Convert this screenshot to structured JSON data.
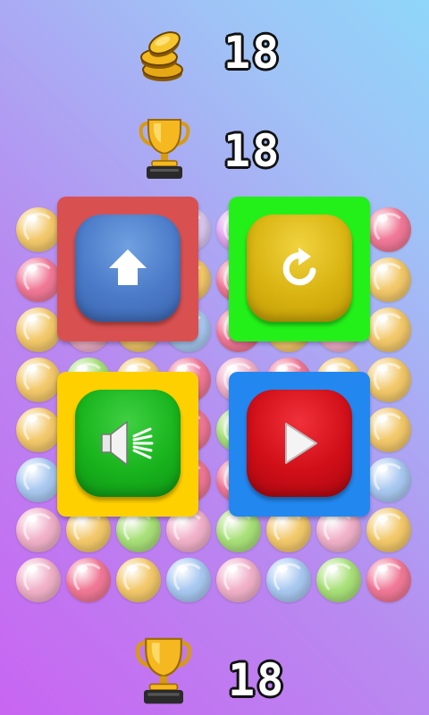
{
  "stats": {
    "coins": "18",
    "best_score": "18",
    "last_score": "18"
  },
  "buttons": [
    {
      "name": "home",
      "icon": "house-icon",
      "tile_color": "#d95050",
      "button_color": "#4b7ac8"
    },
    {
      "name": "restart",
      "icon": "restart-icon",
      "tile_color": "#23f019",
      "button_color": "#d8b310"
    },
    {
      "name": "sound",
      "icon": "speaker-icon",
      "tile_color": "#ffd000",
      "button_color": "#18b31d"
    },
    {
      "name": "play",
      "icon": "play-icon",
      "tile_color": "#2288f0",
      "button_color": "#d00e18"
    }
  ],
  "background_balls": [
    [
      "#f2c86a",
      "#f08fa8",
      "#f3cc6e",
      "#d8c8f0",
      "#e1a5f0",
      "#8fd0f0",
      "#f2c86a",
      "#f07896"
    ],
    [
      "#f07896",
      "#a8c8f0",
      "#f0b0c8",
      "#f2c86a",
      "#f07896",
      "#f07896",
      "#f0b0c8",
      "#f2c86a"
    ],
    [
      "#f2c86a",
      "#f0b0c8",
      "#f2c86a",
      "#a8c8f0",
      "#f07896",
      "#f2c86a",
      "#f0b0c8",
      "#f2c86a"
    ],
    [
      "#f2c86a",
      "#a8e078",
      "#f2c86a",
      "#f07896",
      "#f0b0c8",
      "#f07896",
      "#f2c86a",
      "#f2c86a"
    ],
    [
      "#f2c86a",
      "#f0b0c8",
      "#a8e078",
      "#f07896",
      "#a8e078",
      "#f2c86a",
      "#a8c8f0",
      "#f2c86a"
    ],
    [
      "#a8c8f0",
      "#f07896",
      "#f2c86a",
      "#f07896",
      "#f07896",
      "#f2c86a",
      "#f07896",
      "#a8c8f0"
    ],
    [
      "#f0b0c8",
      "#f2c86a",
      "#a8e078",
      "#f0b0c8",
      "#a8e078",
      "#f2c86a",
      "#f0b0c8",
      "#f2c86a"
    ],
    [
      "#f0b0c8",
      "#f07896",
      "#f2c86a",
      "#a8c8f0",
      "#f0b0c8",
      "#a8c8f0",
      "#a8e078",
      "#f07896"
    ]
  ]
}
